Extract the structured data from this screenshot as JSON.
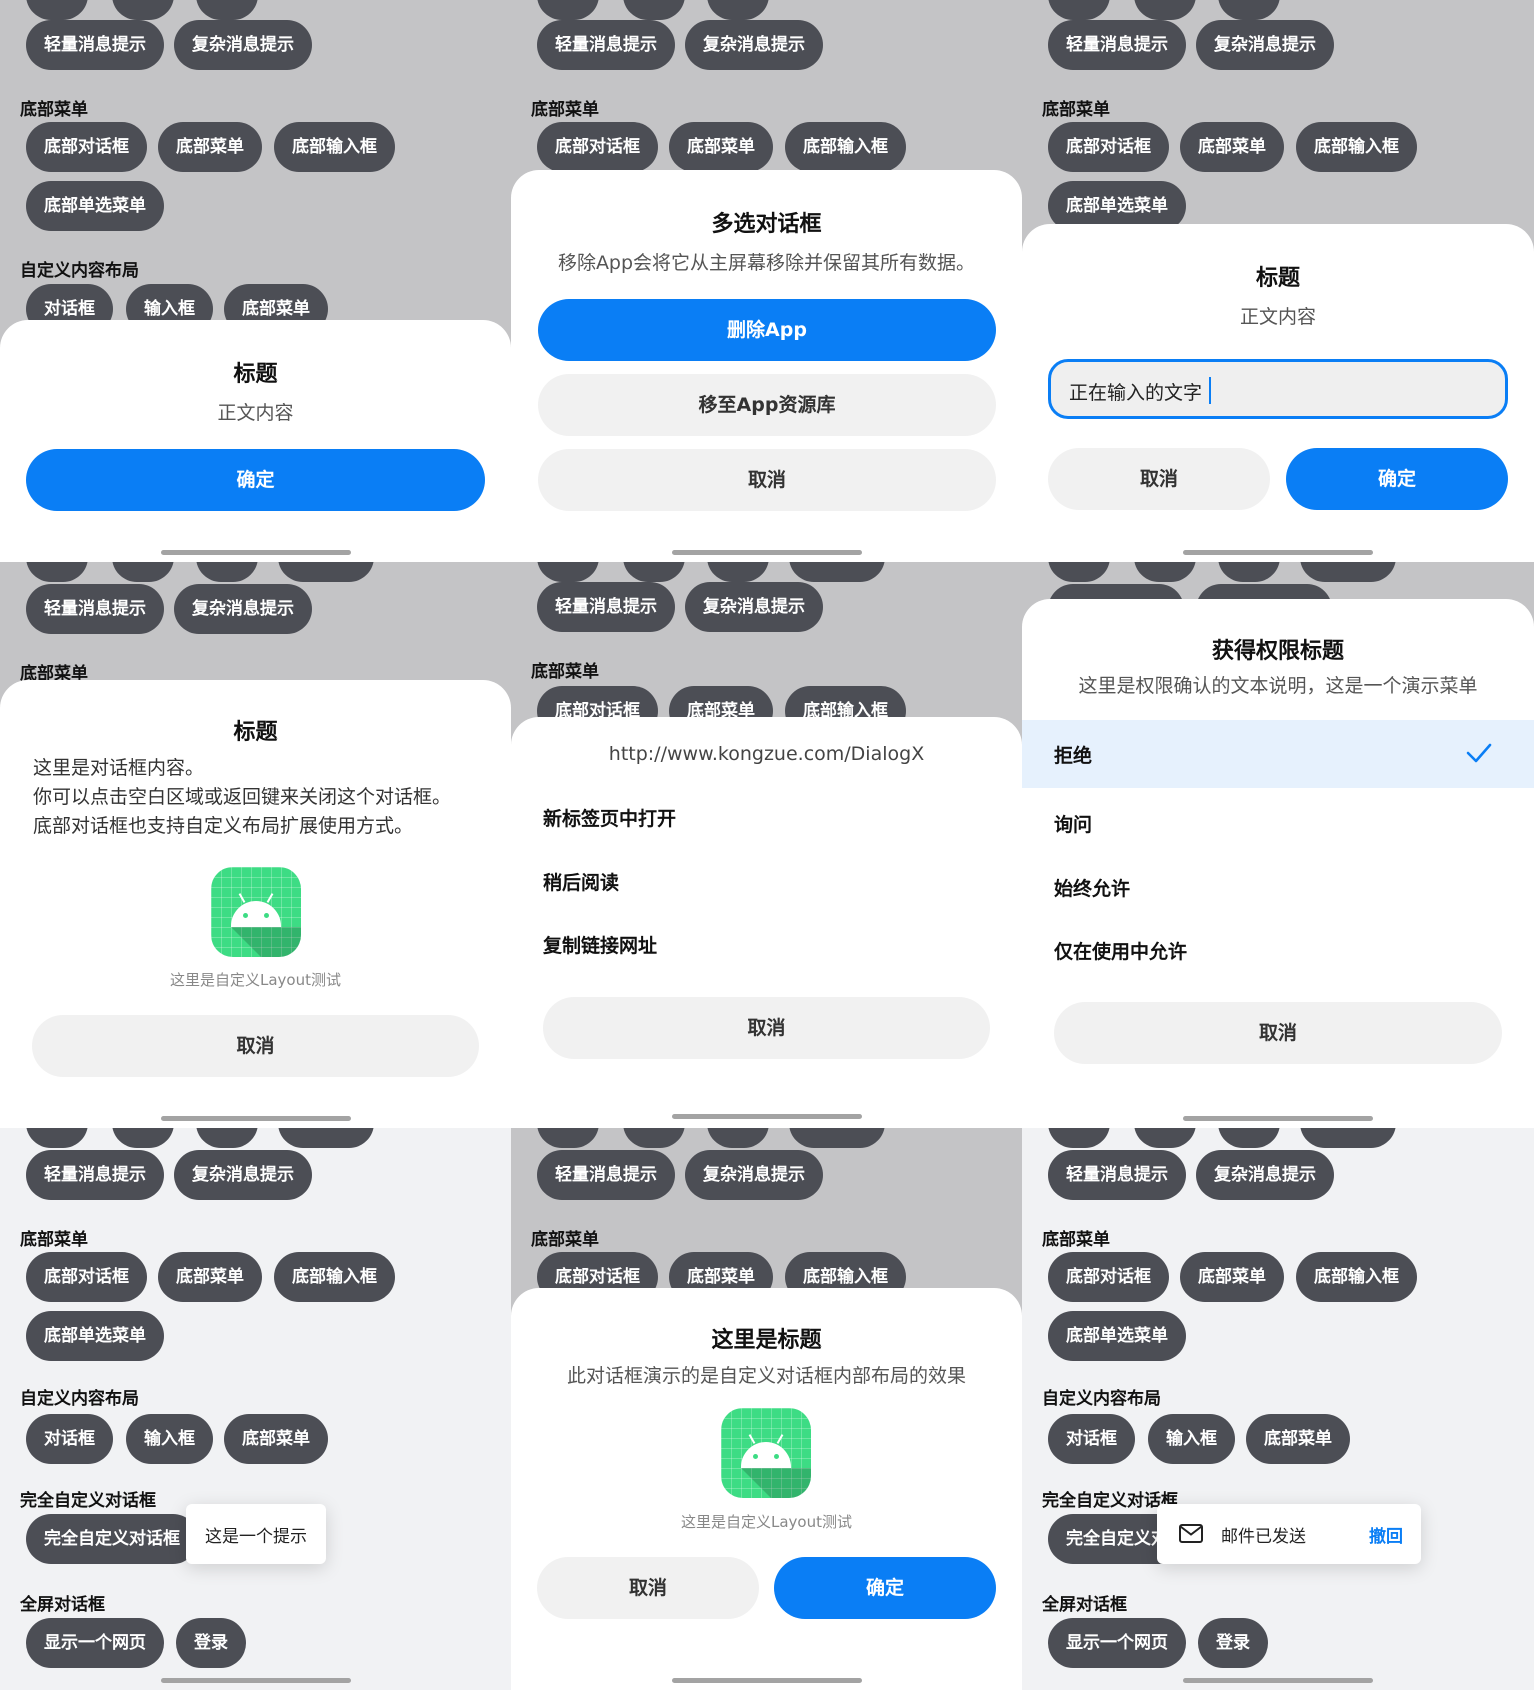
{
  "bg": {
    "s_bottom_menu": "底部菜单",
    "s_custom_layout": "自定义内容布局",
    "s_full_custom": "完全自定义对话框",
    "s_fullscreen": "全屏对话框",
    "light_tip": "轻量消息提示",
    "complex_tip": "复杂消息提示",
    "bottom_dialog": "底部对话框",
    "bottom_menu": "底部菜单",
    "bottom_input": "底部输入框",
    "bottom_select_menu": "底部单选菜单",
    "dialog": "对话框",
    "input": "输入框",
    "full_custom_btn": "完全自定义对话框",
    "show_webpage": "显示一个网页",
    "login": "登录"
  },
  "p0": {
    "title": "标题",
    "body": "正文内容",
    "ok": "确定"
  },
  "p1": {
    "title": "多选对话框",
    "sub": "移除App会将它从主屏幕移除并保留其所有数据。",
    "delete": "删除App",
    "move": "移至App资源库",
    "cancel": "取消"
  },
  "p2": {
    "title": "标题",
    "body": "正文内容",
    "input_value": "正在输入的文字",
    "cancel": "取消",
    "ok": "确定"
  },
  "p3": {
    "title": "标题",
    "line1": "这里是对话框内容。",
    "line2": "你可以点击空白区域或返回键来关闭这个对话框。",
    "line3": "底部对话框也支持自定义布局扩展使用方式。",
    "caption": "这里是自定义Layout测试",
    "cancel": "取消"
  },
  "p4": {
    "url": "http://www.kongzue.com/DialogX",
    "items": [
      "新标签页中打开",
      "稍后阅读",
      "复制链接网址"
    ],
    "cancel": "取消"
  },
  "p5": {
    "title": "获得权限标题",
    "sub": "这里是权限确认的文本说明，这是一个演示菜单",
    "items": [
      "拒绝",
      "询问",
      "始终允许",
      "仅在使用中允许"
    ],
    "selected_index": 0,
    "cancel": "取消"
  },
  "p6": {
    "tip": "这是一个提示"
  },
  "p7": {
    "title": "这里是标题",
    "sub": "此对话框演示的是自定义对话框内部布局的效果",
    "caption": "这里是自定义Layout测试",
    "cancel": "取消",
    "ok": "确定"
  },
  "p8": {
    "toast_text": "邮件已发送",
    "toast_action": "撤回"
  },
  "colors": {
    "accent": "#0a7ef5",
    "chip": "#4c4e55",
    "dim_bg": "#c4c4c6",
    "light_bg": "#f1f2f4",
    "selected_row": "#e6f1fd"
  },
  "icons": [
    "android-icon",
    "check-icon",
    "mail-icon"
  ]
}
